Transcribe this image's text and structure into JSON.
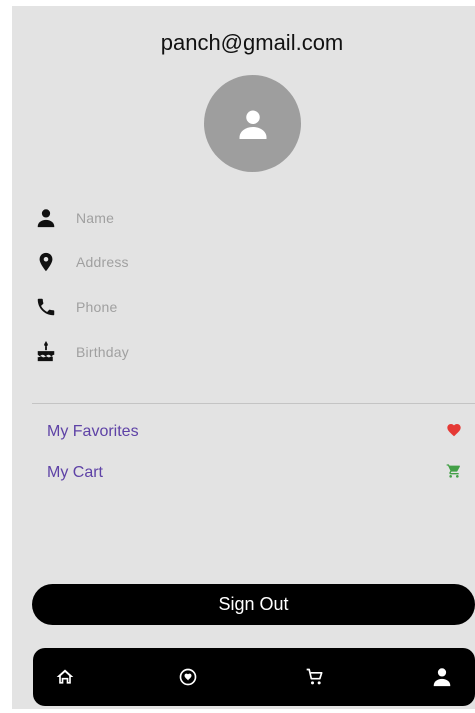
{
  "profile": {
    "email": "panch@gmail.com",
    "avatar_icon": "person-icon"
  },
  "fields": [
    {
      "icon": "person-icon",
      "placeholder": "Name"
    },
    {
      "icon": "location-pin-icon",
      "placeholder": "Address"
    },
    {
      "icon": "phone-icon",
      "placeholder": "Phone"
    },
    {
      "icon": "cake-icon",
      "placeholder": "Birthday"
    }
  ],
  "menu": {
    "favorites": {
      "label": "My Favorites",
      "icon": "heart-icon",
      "icon_color": "#e53935"
    },
    "cart": {
      "label": "My Cart",
      "icon": "cart-icon",
      "icon_color": "#43a047"
    }
  },
  "actions": {
    "sign_out_label": "Sign Out"
  },
  "bottom_nav": [
    {
      "name": "home",
      "icon": "home-icon"
    },
    {
      "name": "favorites",
      "icon": "heart-circle-icon"
    },
    {
      "name": "cart",
      "icon": "cart-icon"
    },
    {
      "name": "profile",
      "icon": "person-icon"
    }
  ],
  "colors": {
    "background": "#e3e3e3",
    "accent_text": "#5e42a6",
    "avatar_bg": "#9e9e9e",
    "bar": "#000000"
  }
}
